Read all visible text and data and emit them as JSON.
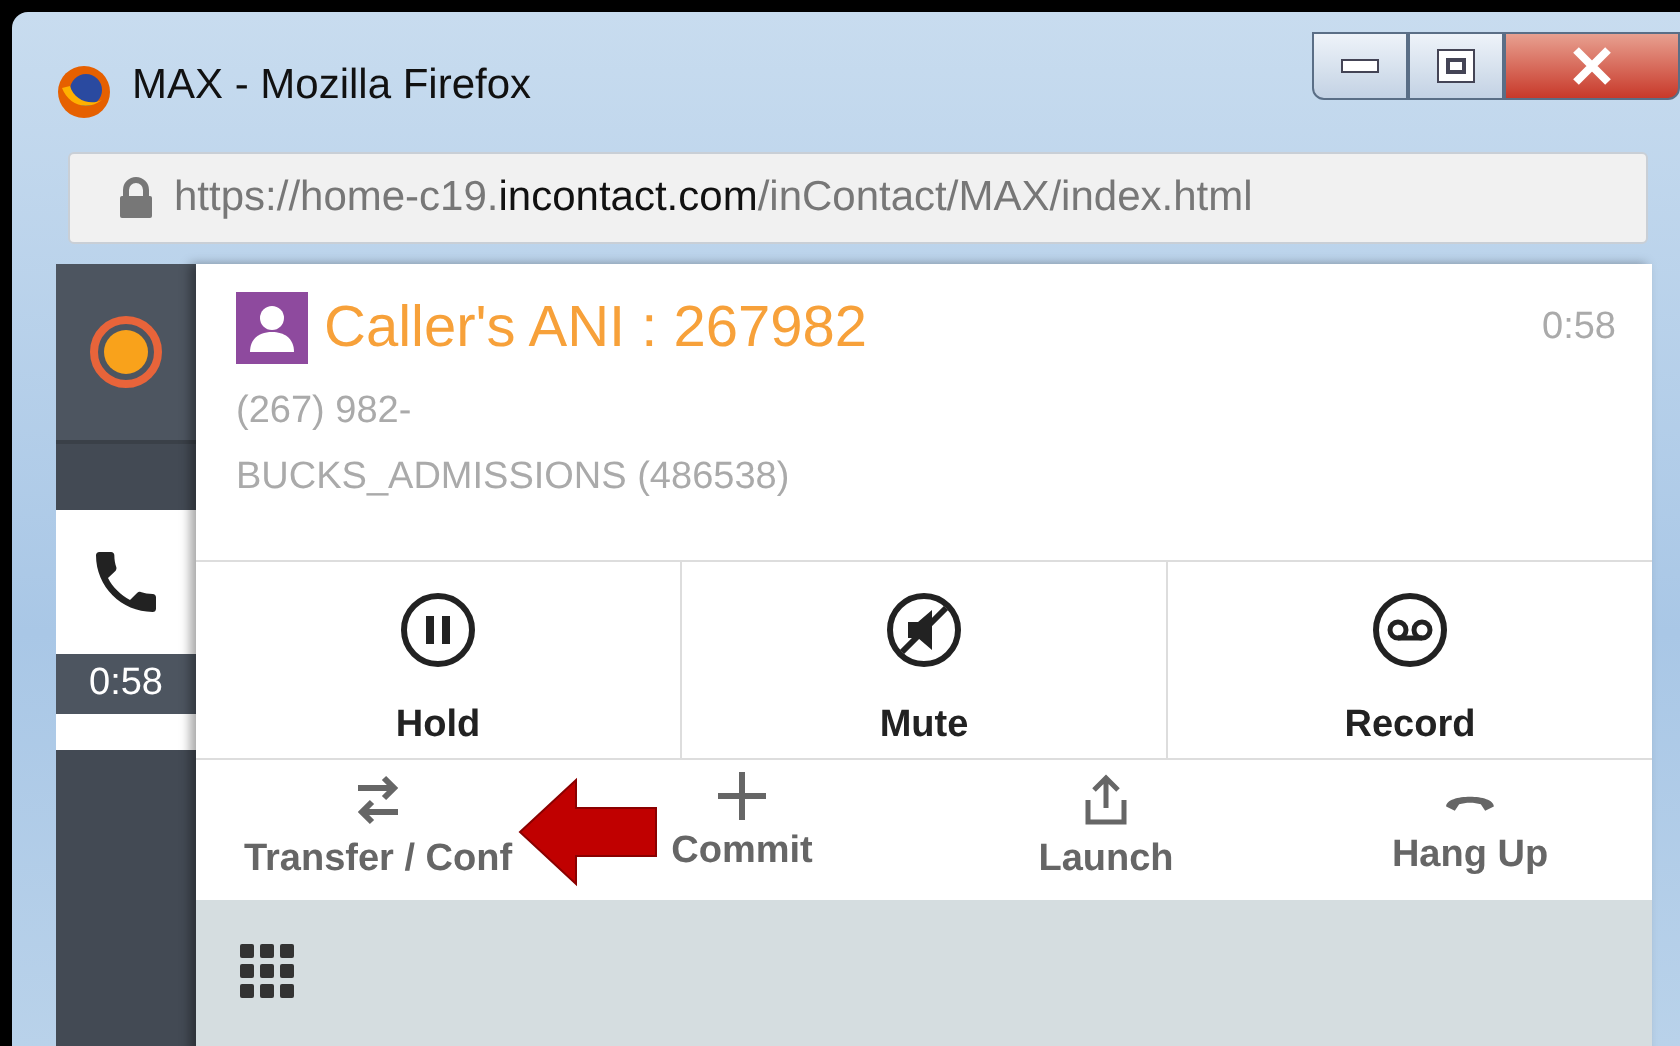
{
  "window": {
    "title": "MAX - Mozilla Firefox"
  },
  "address_bar": {
    "url_prefix": "https://home-c19.",
    "url_domain": "incontact.com",
    "url_path": "/inContact/MAX/index.html"
  },
  "sidebar": {
    "call_timer": "0:58"
  },
  "contact": {
    "title": "Caller's ANI : 267982",
    "elapsed": "0:58",
    "phone": "(267) 982-",
    "skill": "BUCKS_ADMISSIONS (486538)"
  },
  "primary_actions": [
    {
      "label": "Hold",
      "kind": "hold"
    },
    {
      "label": "Mute",
      "kind": "mute"
    },
    {
      "label": "Record",
      "kind": "record"
    }
  ],
  "secondary_actions": [
    {
      "label": "Transfer / Conf",
      "kind": "transfer"
    },
    {
      "label": "Commit",
      "kind": "commit"
    },
    {
      "label": "Launch",
      "kind": "launch"
    },
    {
      "label": "Hang Up",
      "kind": "hangup"
    }
  ]
}
